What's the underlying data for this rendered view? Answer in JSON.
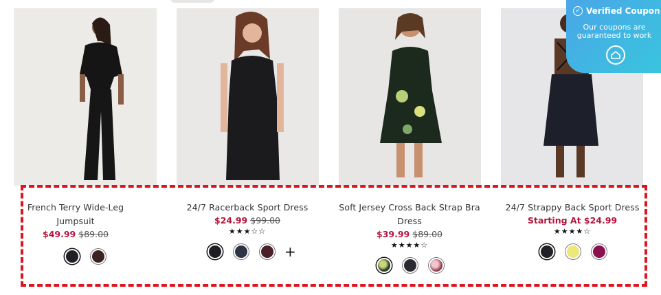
{
  "coupon": {
    "title": "Verified Coupon",
    "subtitle": "Our coupons are guaranteed to work",
    "check_icon": "check-circle-icon",
    "home_icon": "home-icon"
  },
  "products": [
    {
      "name": "French Terry Wide-Leg Jumpsuit",
      "price": "$49.99",
      "old_price": "$89.00",
      "rating": "",
      "swatches": [
        "#1f2024",
        "#3a2321"
      ],
      "more_colors": false
    },
    {
      "name": "24/7 Racerback Sport Dress",
      "price": "$24.99",
      "old_price": "$99.00",
      "rating": "★★★☆☆",
      "swatches": [
        "#1e1f23",
        "#2f3444",
        "#4a1f2a"
      ],
      "more_colors": true,
      "more_label": "+"
    },
    {
      "name": "Soft Jersey Cross Back Strap Bra Dress",
      "price": "$39.99",
      "old_price": "$89.00",
      "rating": "★★★★☆",
      "swatches": [
        "pattern-green",
        "#2a2830",
        "pattern-pink"
      ],
      "more_colors": false
    },
    {
      "name": "24/7 Strappy Back Sport Dress",
      "price": "Starting At $24.99",
      "old_price": "",
      "rating": "★★★★☆",
      "swatches": [
        "#1f2127",
        "#ece87a",
        "#8c0f4e"
      ],
      "more_colors": false
    }
  ]
}
